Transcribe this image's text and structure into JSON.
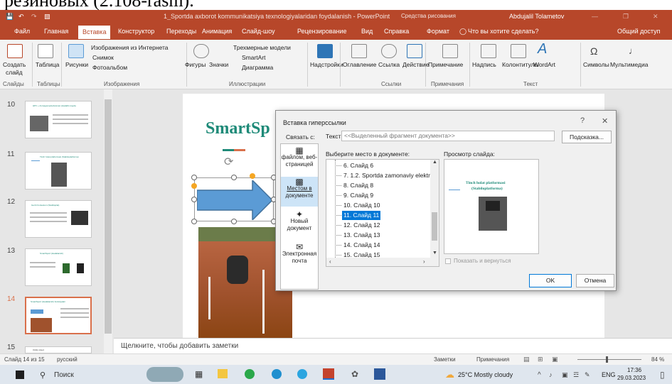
{
  "doc_header": "резиновых (2.108-rasm).",
  "titlebar": {
    "filename": "1_Sportda axborot kommunikatsiya texnologiyalaridan foydalanish  -  PowerPoint",
    "context": "Средства рисования",
    "user": "Abdujalil Tolametov"
  },
  "tabs": [
    "Файл",
    "Главная",
    "Вставка",
    "Конструктор",
    "Переходы",
    "Анимация",
    "Слайд-шоу",
    "Рецензирование",
    "Вид",
    "Справка",
    "Формат"
  ],
  "tellme": "Что вы хотите сделать?",
  "share": "Общий доступ",
  "ribbon": {
    "new_slide": [
      "Создать",
      "слайд"
    ],
    "table": "Таблица",
    "pictures": "Рисунки",
    "online_pictures": "Изображения из Интернета",
    "screenshot": "Снимок",
    "photo_album": "Фотоальбом",
    "shapes": "Фигуры",
    "icons": "Значки",
    "models3d": "Трехмерные модели",
    "smartart": "SmartArt",
    "chart": "Диаграмма",
    "addins": "Надстройки",
    "zoom": "Оглавление",
    "link": "Ссылка",
    "action": "Действие",
    "comment": "Примечание",
    "textbox": "Надпись",
    "header_footer": "Колонтитулы",
    "wordart": "WordArt",
    "symbols": "Символы",
    "media": "Мультимедиа",
    "groups": [
      "Слайды",
      "Таблицы",
      "Изображения",
      "Иллюстрации",
      "Ссылки",
      "Примечания",
      "Текст"
    ]
  },
  "thumbs": [
    {
      "num": "10",
      "title": "HPV + Axmagomedovlanman (Hadalf) mayda"
    },
    {
      "num": "11",
      "title": "Tinch holat platformasi (Stabiloplatforma)"
    },
    {
      "num": "12",
      "title": "Gerrit Fontestum (Stabiloplat)"
    },
    {
      "num": "13",
      "title": "SmartSport (Hadalanish)"
    },
    {
      "num": "14",
      "title": "SmartSport (Hadalanish) funksiyalari"
    },
    {
      "num": "15",
      "title": "Oddiy slayd"
    }
  ],
  "slide": {
    "title": "SmartSp"
  },
  "notes": "Щелкните, чтобы добавить заметки",
  "status": {
    "slide_of": "Слайд 14 из 15",
    "language": "русский",
    "notes_btn": "Заметки",
    "comments_btn": "Примечания",
    "zoom": "84 %"
  },
  "dialog": {
    "title": "Вставка гиперссылки",
    "link_to": "Связать с:",
    "text_label": "Текст:",
    "text_value": "<<Выделенный фрагмент документа>>",
    "screentip": "Подсказка...",
    "left_items": [
      {
        "l1": "файлом, веб-",
        "l2": "страницей"
      },
      {
        "l1": "Местом в",
        "l2": "документе"
      },
      {
        "l1": "Новый",
        "l2": "документ"
      },
      {
        "l1": "Электронная",
        "l2": "почта"
      }
    ],
    "place_label": "Выберите место в документе:",
    "places": [
      "6. Слайд 6",
      "7. 1.2. Sportda zamonaviy elektr",
      "8. Слайд 8",
      "9. Слайд 9",
      "10. Слайд 10",
      "11. Слайд 11",
      "12. Слайд 12",
      "13. Слайд 13",
      "14. Слайд 14",
      "15. Слайд 15"
    ],
    "preview_label": "Просмотр слайда:",
    "preview_title_1": "Tinch holat platformasi",
    "preview_title_2": "(Stabiloplatforma)",
    "show_return": "Показать и вернуться",
    "ok": "OK",
    "cancel": "Отмена",
    "help": "?",
    "close": "✕"
  },
  "taskbar": {
    "search": "Поиск",
    "weather": "25°C  Mostly cloudy",
    "lang": "ENG",
    "time": "17:36",
    "date": "29.03.2023"
  },
  "colors": {
    "accent": "#b7472a",
    "select": "#0078d7",
    "thumb_border": "#d9704b",
    "slide_title": "#1e8a78",
    "arrow": "#5b9bd5"
  }
}
